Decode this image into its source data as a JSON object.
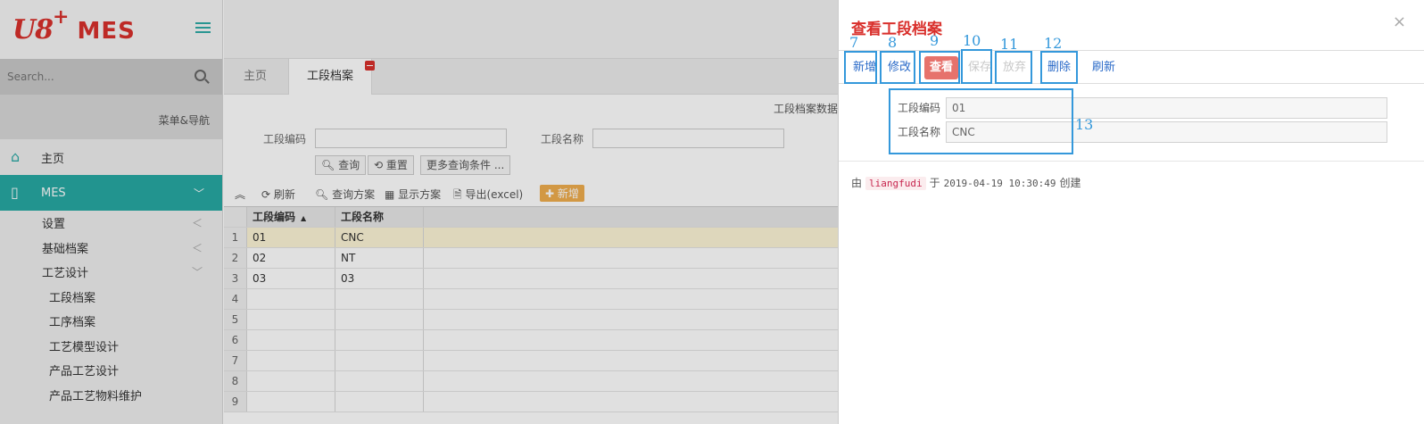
{
  "sidebar": {
    "logo": {
      "brand": "U8",
      "plus": "+",
      "product": "MES"
    },
    "search_placeholder": "Search...",
    "nav_header": "菜单&导航",
    "items": [
      {
        "label": "主页"
      },
      {
        "label": "MES"
      }
    ],
    "sub_items": [
      {
        "label": "设置"
      },
      {
        "label": "基础档案"
      },
      {
        "label": "工艺设计"
      }
    ],
    "sub_sub_items": [
      {
        "label": "工段档案"
      },
      {
        "label": "工序档案"
      },
      {
        "label": "工艺模型设计"
      },
      {
        "label": "产品工艺设计"
      },
      {
        "label": "产品工艺物料维护"
      }
    ]
  },
  "main": {
    "tabs": [
      {
        "label": "主页"
      },
      {
        "label": "工段档案"
      }
    ],
    "data_label": "工段档案数据",
    "filters": {
      "code_label": "工段编码",
      "name_label": "工段名称",
      "query": "查询",
      "reset": "重置",
      "more": "更多查询条件 ..."
    },
    "toolbar": {
      "refresh": "刷新",
      "query_scheme": "查询方案",
      "display_scheme": "显示方案",
      "export": "导出(excel)",
      "add": "新增"
    },
    "grid": {
      "columns": [
        "工段编码",
        "工段名称"
      ],
      "rows": [
        {
          "n": "1",
          "code": "01",
          "name": "CNC"
        },
        {
          "n": "2",
          "code": "02",
          "name": "NT"
        },
        {
          "n": "3",
          "code": "03",
          "name": "03"
        },
        {
          "n": "4",
          "code": "",
          "name": ""
        },
        {
          "n": "5",
          "code": "",
          "name": ""
        },
        {
          "n": "6",
          "code": "",
          "name": ""
        },
        {
          "n": "7",
          "code": "",
          "name": ""
        },
        {
          "n": "8",
          "code": "",
          "name": ""
        },
        {
          "n": "9",
          "code": "",
          "name": ""
        }
      ]
    }
  },
  "dialog": {
    "title": "查看工段档案",
    "close": "×",
    "buttons": {
      "add": "新增",
      "edit": "修改",
      "view": "查看",
      "save": "保存",
      "discard": "放弃",
      "delete": "删除",
      "refresh": "刷新"
    },
    "form": {
      "code_label": "工段编码",
      "code_value": "01",
      "name_label": "工段名称",
      "name_value": "CNC"
    },
    "audit": {
      "by": "由",
      "user": "liangfudi",
      "at": "于",
      "timestamp": "2019-04-19 10:30:49",
      "action": "创建"
    }
  },
  "annotations": [
    "7",
    "8",
    "9",
    "10",
    "11",
    "12",
    "13"
  ],
  "colors": {
    "accent": "#27a9a3",
    "brand_red": "#d9302c",
    "annotation_blue": "#3498db",
    "add_orange": "#f0ad4e"
  }
}
